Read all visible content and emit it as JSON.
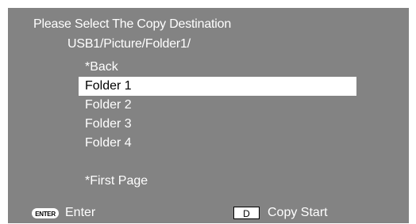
{
  "dialog": {
    "title": "Please Select The Copy Destination",
    "path": "USB1/Picture/Folder1/"
  },
  "list": {
    "items": [
      {
        "label": "*Back",
        "selected": false
      },
      {
        "label": "Folder 1",
        "selected": true
      },
      {
        "label": "Folder 2",
        "selected": false
      },
      {
        "label": "Folder 3",
        "selected": false
      },
      {
        "label": "Folder 4",
        "selected": false
      }
    ],
    "first_page_label": "*First Page"
  },
  "footer": {
    "enter_key": "ENTER",
    "enter_label": "Enter",
    "copy_key": "D",
    "copy_label": "Copy Start"
  },
  "colors": {
    "background": "#838383",
    "selection": "#ffffff",
    "text": "#ffffff"
  }
}
